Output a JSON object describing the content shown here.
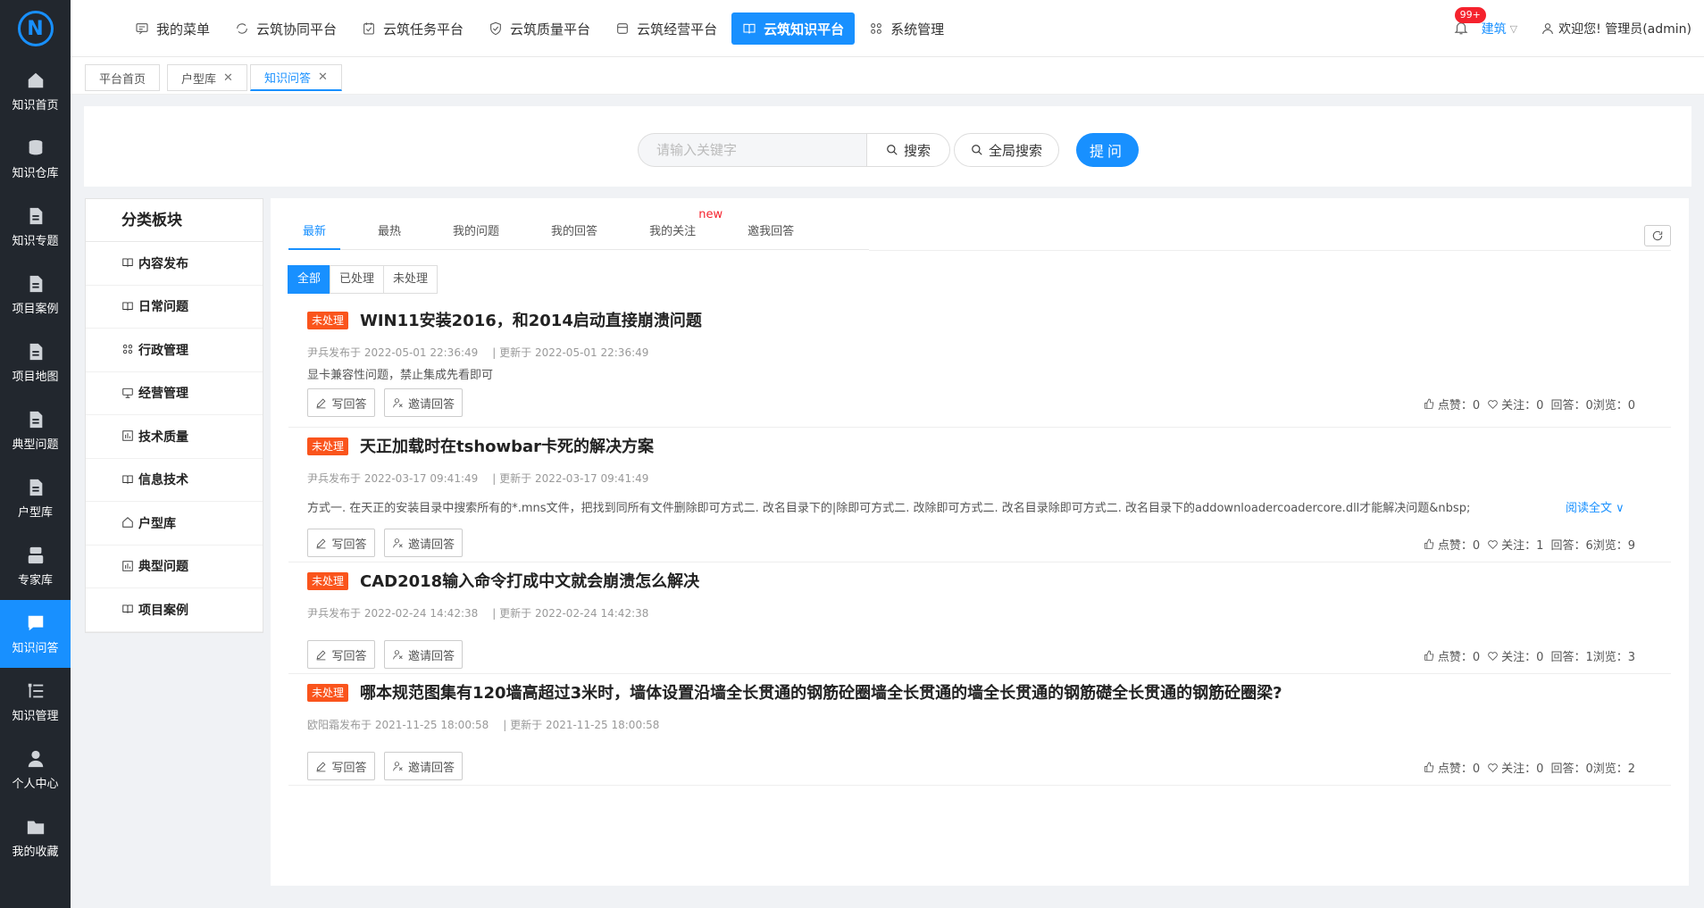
{
  "sidebar": {
    "logo": "N",
    "items": [
      {
        "label": "知识首页",
        "icon": "home-icon",
        "active": false
      },
      {
        "label": "知识仓库",
        "icon": "database-icon",
        "active": false
      },
      {
        "label": "知识专题",
        "icon": "document-icon",
        "active": false
      },
      {
        "label": "项目案例",
        "icon": "document-icon",
        "active": false
      },
      {
        "label": "项目地图",
        "icon": "document-icon",
        "active": false
      },
      {
        "label": "典型问题",
        "icon": "document-icon",
        "active": false
      },
      {
        "label": "户型库",
        "icon": "document-icon",
        "active": false
      },
      {
        "label": "专家库",
        "icon": "expert-icon",
        "active": false
      },
      {
        "label": "知识问答",
        "icon": "qa-icon",
        "active": true
      },
      {
        "label": "知识管理",
        "icon": "list-tree-icon",
        "active": false
      },
      {
        "label": "个人中心",
        "icon": "user-icon",
        "active": false
      },
      {
        "label": "我的收藏",
        "icon": "folder-icon",
        "active": false
      }
    ]
  },
  "topnav": {
    "items": [
      {
        "label": "我的菜单",
        "icon": "menu-chat-icon",
        "active": false
      },
      {
        "label": "云筑协同平台",
        "icon": "sync-icon",
        "active": false
      },
      {
        "label": "云筑任务平台",
        "icon": "task-icon",
        "active": false
      },
      {
        "label": "云筑质量平台",
        "icon": "shield-icon",
        "active": false
      },
      {
        "label": "云筑经营平台",
        "icon": "store-icon",
        "active": false
      },
      {
        "label": "云筑知识平台",
        "icon": "book-icon",
        "active": true
      },
      {
        "label": "系统管理",
        "icon": "grid-icon",
        "active": false
      }
    ],
    "badge": "99+",
    "org": "建筑",
    "welcome": "欢迎您! 管理员(admin)"
  },
  "page_tabs": [
    {
      "label": "平台首页",
      "closable": false,
      "active": false
    },
    {
      "label": "户型库",
      "closable": true,
      "active": false
    },
    {
      "label": "知识问答",
      "closable": true,
      "active": true
    }
  ],
  "search": {
    "placeholder": "请输入关键字",
    "search_label": "搜索",
    "global_label": "全局搜索",
    "ask_label": "提问"
  },
  "categories": {
    "title": "分类板块",
    "items": [
      {
        "label": "内容发布",
        "icon": "book-icon"
      },
      {
        "label": "日常问题",
        "icon": "book-icon"
      },
      {
        "label": "行政管理",
        "icon": "grid-icon"
      },
      {
        "label": "经营管理",
        "icon": "monitor-icon"
      },
      {
        "label": "技术质量",
        "icon": "chart-icon"
      },
      {
        "label": "信息技术",
        "icon": "book-icon"
      },
      {
        "label": "户型库",
        "icon": "house-icon"
      },
      {
        "label": "典型问题",
        "icon": "chart-icon"
      },
      {
        "label": "项目案例",
        "icon": "book-icon"
      }
    ]
  },
  "qtabs": [
    {
      "label": "最新",
      "active": true,
      "new": ""
    },
    {
      "label": "最热",
      "active": false,
      "new": ""
    },
    {
      "label": "我的问题",
      "active": false,
      "new": ""
    },
    {
      "label": "我的回答",
      "active": false,
      "new": ""
    },
    {
      "label": "我的关注",
      "active": false,
      "new": "new"
    },
    {
      "label": "邀我回答",
      "active": false,
      "new": ""
    }
  ],
  "filters": [
    {
      "label": "全部",
      "active": true
    },
    {
      "label": "已处理",
      "active": false
    },
    {
      "label": "未处理",
      "active": false
    }
  ],
  "actions": {
    "write": "写回答",
    "invite": "邀请回答",
    "read_more": "阅读全文"
  },
  "questions": [
    {
      "status": "未处理",
      "title": "WIN11安装2016，和2014启动直接崩溃问题",
      "author_published": "尹兵发布于 2022-05-01 22:36:49",
      "updated": "| 更新于 2022-05-01 22:36:49",
      "desc": "显卡兼容性问题，禁止集成先看即可",
      "has_more": false,
      "stats": {
        "likes": "点赞：0",
        "follows": "关注：0",
        "answers": "回答：0",
        "views": "浏览：0"
      }
    },
    {
      "status": "未处理",
      "title": "天正加载时在tshowbar卡死的解决方案",
      "author_published": "尹兵发布于 2022-03-17 09:41:49",
      "updated": "| 更新于 2022-03-17 09:41:49",
      "desc": "方式一. 在天正的安装目录中搜索所有的*.mns文件，把找到同所有文件删除即可方式二. 改名目录下的|除即可方式二. 改除即可方式二. 改名目录除即可方式二. 改名目录下的addownloadercoadercore.dll才能解决问题&nbsp;",
      "has_more": true,
      "stats": {
        "likes": "点赞：0",
        "follows": "关注：1",
        "answers": "回答：6",
        "views": "浏览：9"
      }
    },
    {
      "status": "未处理",
      "title": "CAD2018输入命令打成中文就会崩溃怎么解决",
      "author_published": "尹兵发布于 2022-02-24 14:42:38",
      "updated": "| 更新于 2022-02-24 14:42:38",
      "desc": "",
      "has_more": false,
      "stats": {
        "likes": "点赞：0",
        "follows": "关注：0",
        "answers": "回答：1",
        "views": "浏览：3"
      }
    },
    {
      "status": "未处理",
      "title": "哪本规范图集有120墙高超过3米时，墙体设置沿墙全长贯通的钢筋砼圈墙全长贯通的墙全长贯通的钢筋礎全长贯通的钢筋砼圈梁?",
      "author_published": "欧阳霜发布于 2021-11-25 18:00:58",
      "updated": "| 更新于 2021-11-25 18:00:58",
      "desc": "",
      "has_more": false,
      "stats": {
        "likes": "点赞：0",
        "follows": "关注：0",
        "answers": "回答：0",
        "views": "浏览：2"
      }
    }
  ]
}
